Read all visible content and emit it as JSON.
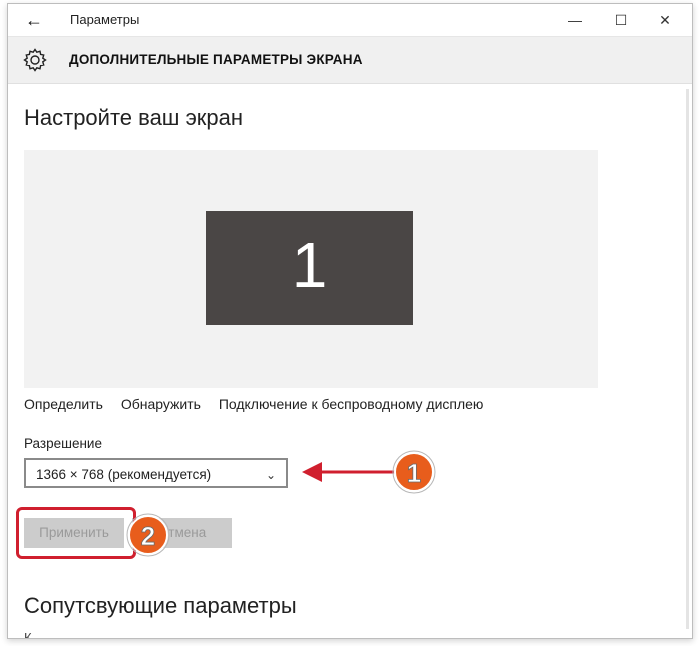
{
  "window": {
    "app_title": "Параметры",
    "back_glyph": "←",
    "minimize_glyph": "—",
    "maximize_glyph": "☐",
    "close_glyph": "✕"
  },
  "header": {
    "icon": "gear-icon",
    "title": "ДОПОЛНИТЕЛЬНЫЕ ПАРАМЕТРЫ ЭКРАНА"
  },
  "main": {
    "heading": "Настройте ваш экран",
    "display_number": "1",
    "links": [
      "Определить",
      "Обнаружить",
      "Подключение к беспроводному дисплею"
    ],
    "resolution_label": "Разрешение",
    "resolution_value": "1366 × 768 (рекомендуется)",
    "apply_button": "Применить",
    "cancel_button": "Отмена",
    "related_heading": "Сопутсвующие параметры",
    "partial_text": "К..."
  },
  "annotations": {
    "callout_1": "1",
    "callout_2": "2",
    "accent_red": "#d01f2e",
    "callout_orange": "#e85d1c"
  }
}
